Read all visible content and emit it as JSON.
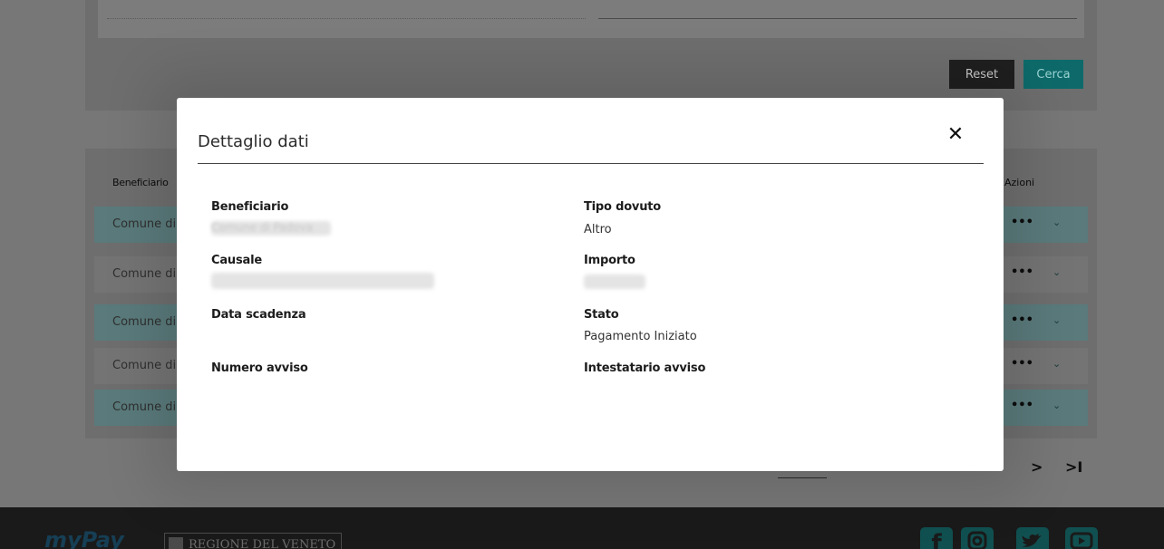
{
  "search": {
    "reset_label": "Reset",
    "search_label": "Cerca"
  },
  "table": {
    "headers": {
      "beneficiario": "Beneficiario",
      "azioni": "Azioni"
    },
    "rows": [
      {
        "beneficiario": "Comune di",
        "actions": "•••"
      },
      {
        "beneficiario": "Comune di",
        "actions": "•••"
      },
      {
        "beneficiario": "Comune di",
        "actions": "•••"
      },
      {
        "beneficiario": "Comune di",
        "actions": "•••"
      },
      {
        "beneficiario": "Comune di",
        "actions": "•••"
      }
    ],
    "chevron": "⌄"
  },
  "pagination": {
    "next": ">",
    "last": ">I"
  },
  "modal": {
    "title": "Dettaglio dati",
    "close": "✕",
    "fields": {
      "beneficiario": {
        "label": "Beneficiario",
        "value": "Comune di Padova"
      },
      "tipo_dovuto": {
        "label": "Tipo dovuto",
        "value": "Altro"
      },
      "causale": {
        "label": "Causale",
        "value": ""
      },
      "importo": {
        "label": "Importo",
        "value": ""
      },
      "data_scadenza": {
        "label": "Data scadenza",
        "value": ""
      },
      "stato": {
        "label": "Stato",
        "value": "Pagamento Iniziato"
      },
      "numero_avviso": {
        "label": "Numero avviso",
        "value": ""
      },
      "intestatario_avviso": {
        "label": "Intestatario avviso",
        "value": ""
      }
    }
  },
  "footer": {
    "logo_mypay": "myPay",
    "logo_regione": "REGIONE DEL VENETO",
    "social": [
      "facebook-icon",
      "instagram-icon",
      "twitter-icon",
      "youtube-icon"
    ]
  },
  "colors": {
    "modal_bg": "#ffffff",
    "accent_teal": "#0e6a6a",
    "footer_bg": "#1a1a1a"
  }
}
